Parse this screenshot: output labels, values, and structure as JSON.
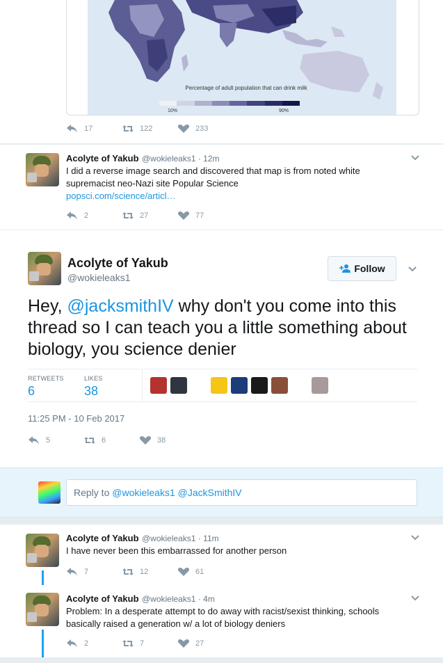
{
  "map_card": {
    "legend_title": "Percentage of adult population that can drink milk",
    "legend_low": "10%",
    "legend_high": "90%",
    "colors": [
      "#f0f0f5",
      "#d3d3e4",
      "#b1b1cf",
      "#8b8bb6",
      "#65659c",
      "#43437f",
      "#2a2a66",
      "#15154d"
    ]
  },
  "tweet_top_actions": {
    "reply": "17",
    "retweet": "122",
    "like": "233"
  },
  "tweet1": {
    "name": "Acolyte of Yakub",
    "handle_time": "@wokieleaks1 · 12m",
    "text": "I did a reverse image search and discovered that map is from noted white supremacist neo-Nazi site Popular Science",
    "link": "popsci.com/science/articl…",
    "reply": "2",
    "retweet": "27",
    "like": "77"
  },
  "main_tweet": {
    "name": "Acolyte of Yakub",
    "handle": "@wokieleaks1",
    "follow_label": "Follow",
    "text_prefix": "Hey, ",
    "mention": "@jacksmithIV",
    "text_suffix": " why don't you come into this thread so I can teach you a little something about biology, you science denier",
    "retweets_label": "RETWEETS",
    "retweets_value": "6",
    "likes_label": "LIKES",
    "likes_value": "38",
    "timestamp": "11:25 PM - 10 Feb 2017",
    "reply": "5",
    "retweet": "6",
    "like": "38",
    "liker_colors": [
      "#b5332e",
      "#2f3640",
      "#ffffff",
      "#f5c518",
      "#1c3c7a",
      "#1a1a1a",
      "#8a4f3a",
      "#ffffff",
      "#a89a9a"
    ]
  },
  "reply_box": {
    "placeholder_prefix": "Reply to ",
    "placeholder_mentions": "@wokieleaks1 @JackSmithIV"
  },
  "tweet2": {
    "name": "Acolyte of Yakub",
    "handle_time": "@wokieleaks1 · 11m",
    "text": "I have never been this embarrassed for another person",
    "reply": "7",
    "retweet": "12",
    "like": "61"
  },
  "tweet3": {
    "name": "Acolyte of Yakub",
    "handle_time": "@wokieleaks1 · 4m",
    "text": "Problem: In a desperate attempt to do away with racist/sexist thinking, schools basically raised a generation w/ a lot of biology deniers",
    "reply": "2",
    "retweet": "7",
    "like": "27"
  }
}
